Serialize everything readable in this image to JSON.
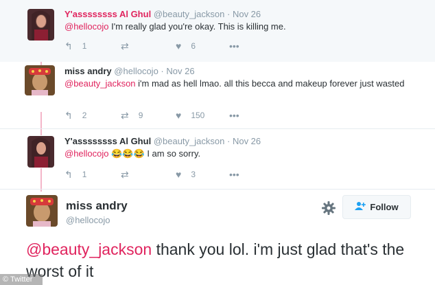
{
  "tweets": [
    {
      "name": "Y'assssssss Al Ghul",
      "handle": "@beauty_jackson",
      "dot": "·",
      "date": "Nov 26",
      "mention": "@hellocojo",
      "text": " I'm really glad you're okay. This is killing me.",
      "replies": "1",
      "retweets": "",
      "likes": "6"
    },
    {
      "name": "miss andry",
      "handle": "@hellocojo",
      "dot": "·",
      "date": "Nov 26",
      "mention": "@beauty_jackson",
      "text": " i'm mad as hell lmao. all this becca and makeup forever just wasted",
      "replies": "2",
      "retweets": "9",
      "likes": "150"
    },
    {
      "name": "Y'assssssss Al Ghul",
      "handle": "@beauty_jackson",
      "dot": "·",
      "date": "Nov 26",
      "mention": "@hellocojo",
      "emoji": "😂😂😂",
      "text": " I am so sorry.",
      "replies": "1",
      "retweets": "",
      "likes": "3"
    }
  ],
  "main_tweet": {
    "name": "miss andry",
    "handle": "@hellocojo",
    "follow_label": "Follow",
    "mention": "@beauty_jackson",
    "text": " thank you lol. i'm just glad that's the worst of it"
  },
  "watermark": "© Twitter",
  "icons": {
    "reply": "reply-icon",
    "retweet": "retweet-icon",
    "like": "heart-icon",
    "more": "more-icon",
    "gear": "gear-icon",
    "follow": "add-user-icon"
  },
  "colors": {
    "mention": "#e0245e",
    "muted": "#8899a6",
    "thread_line": "#f4b6c9"
  }
}
